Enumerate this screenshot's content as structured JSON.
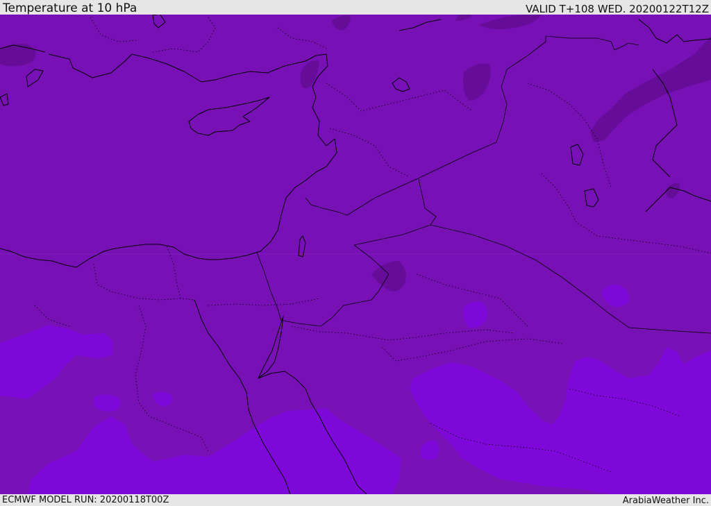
{
  "header": {
    "title": "Temperature at 10 hPa",
    "valid": "VALID T+108 WED. 20200122T12Z"
  },
  "footer": {
    "model_run": "ECMWF MODEL RUN: 20200118T00Z",
    "brand": "ArabiaWeather Inc."
  },
  "map": {
    "region": "Eastern Mediterranean and Middle East",
    "base_color": "#7711b5",
    "warm_zone_color": "#7d08d9",
    "cold_zone_color": "#650c98",
    "coastline_color": "#000000"
  }
}
